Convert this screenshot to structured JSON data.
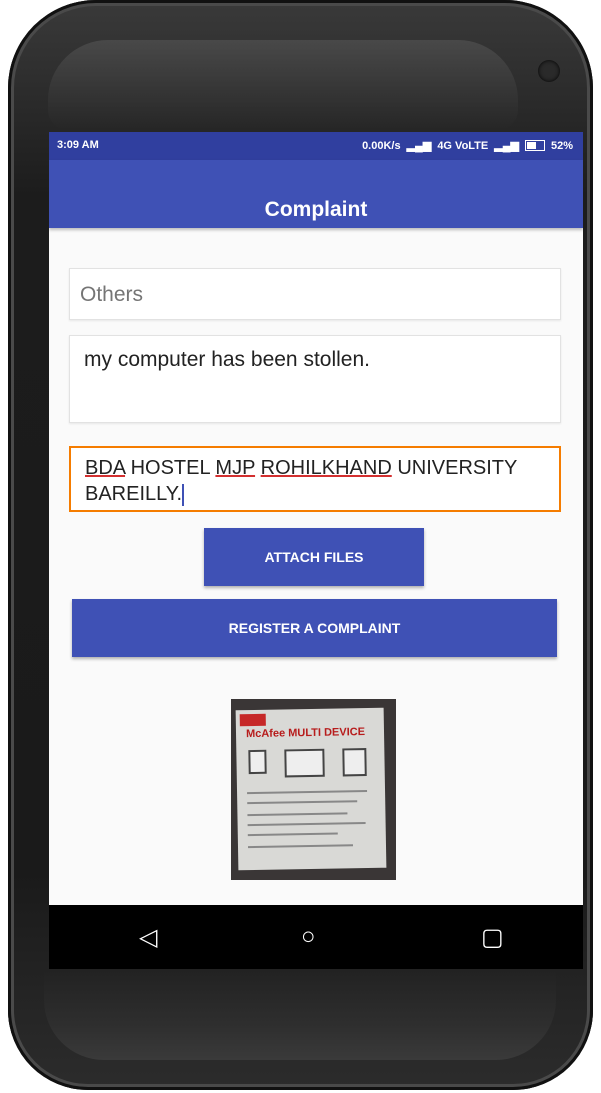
{
  "status_bar": {
    "time": "3:09 AM",
    "network_speed": "0.00K/s",
    "network_label": "4G VoLTE",
    "battery": "52%"
  },
  "app_bar": {
    "title": "Complaint"
  },
  "form": {
    "category_value": "Others",
    "description_value": "my computer  has been stollen.",
    "address_words": [
      "BDA",
      " HOSTEL ",
      "MJP",
      " ",
      "ROHILKHAND",
      " UNIVERSITY BAREILLY."
    ]
  },
  "buttons": {
    "attach_label": "ATTACH FILES",
    "register_label": "REGISTER A COMPLAINT"
  },
  "attachment": {
    "title": "McAfee MULTI DEVICE"
  },
  "nav": {
    "back_icon": "◁",
    "home_icon": "○",
    "recents_icon": "▢"
  },
  "colors": {
    "primary": "#3f51b5",
    "status_bar": "#303f9f",
    "focus_border": "#f57c00"
  }
}
